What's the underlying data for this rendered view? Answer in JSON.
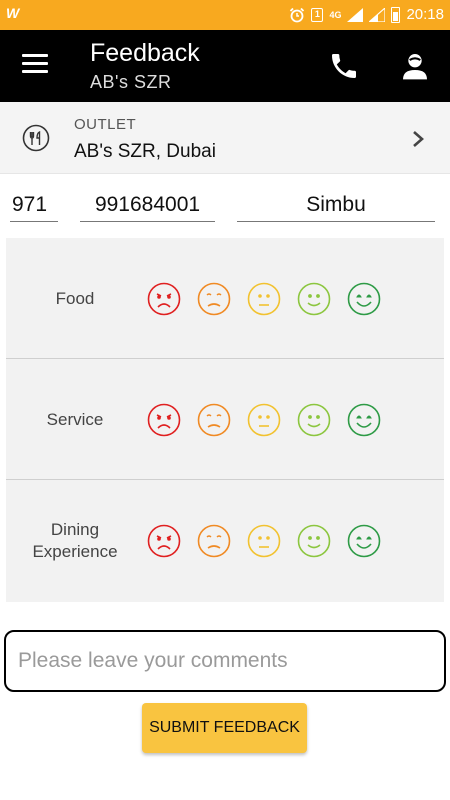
{
  "status_bar": {
    "time": "20:18",
    "network": "4G",
    "sim_badge": "1",
    "app_icon": "W"
  },
  "app_bar": {
    "title": "Feedback",
    "subtitle": "AB's SZR"
  },
  "outlet": {
    "label": "OUTLET",
    "value": "AB's SZR, Dubai"
  },
  "customer": {
    "country_code": "971",
    "phone": "991684001",
    "name": "Simbu"
  },
  "ratings": [
    {
      "label": "Food"
    },
    {
      "label": "Service"
    },
    {
      "label": "Dining Experience"
    }
  ],
  "rating_scale": [
    {
      "name": "very-bad",
      "color": "#e02020"
    },
    {
      "name": "bad",
      "color": "#f08a24"
    },
    {
      "name": "neutral",
      "color": "#f2c230"
    },
    {
      "name": "good",
      "color": "#8cc63f"
    },
    {
      "name": "very-good",
      "color": "#2e9b46"
    }
  ],
  "comments": {
    "placeholder": "Please leave your comments",
    "value": ""
  },
  "submit_label": "SUBMIT FEEDBACK",
  "colors": {
    "status_bar": "#f8a91f",
    "app_bar": "#000000",
    "submit_button": "#f9c440"
  }
}
